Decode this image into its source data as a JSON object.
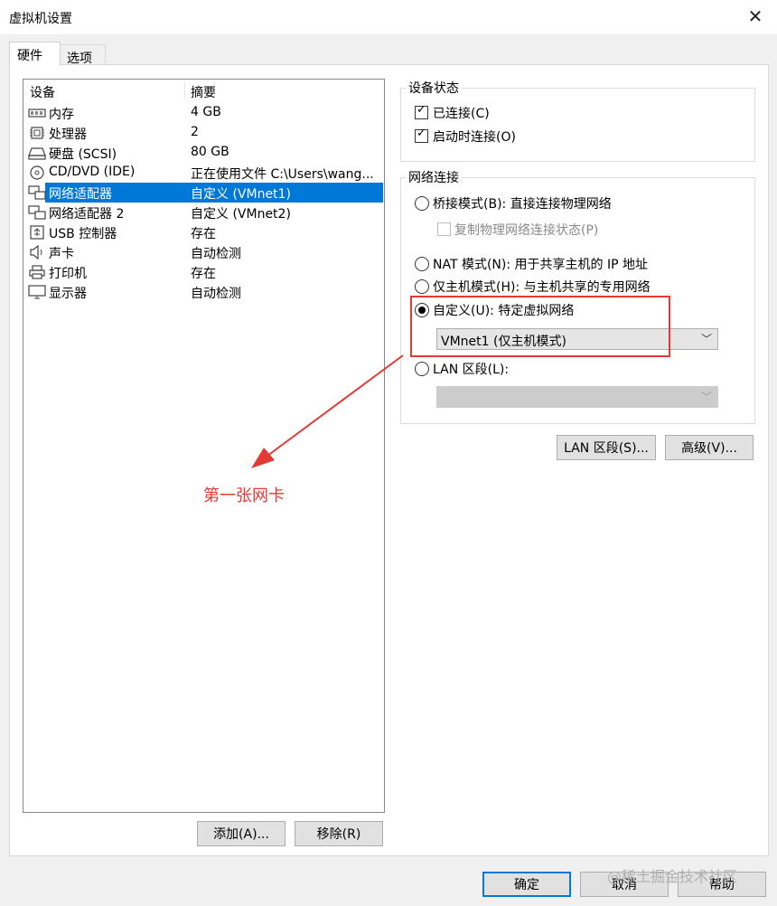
{
  "window": {
    "title": "虚拟机设置",
    "close_glyph": "✕"
  },
  "tabs": [
    {
      "label": "硬件"
    },
    {
      "label": "选项"
    }
  ],
  "device_list": {
    "headers": {
      "device": "设备",
      "summary": "摘要"
    },
    "rows": [
      {
        "icon": "memory-icon",
        "name": "内存",
        "summary": "4 GB"
      },
      {
        "icon": "processor-icon",
        "name": "处理器",
        "summary": "2"
      },
      {
        "icon": "hard-disk-icon",
        "name": "硬盘 (SCSI)",
        "summary": "80 GB"
      },
      {
        "icon": "cd-dvd-icon",
        "name": "CD/DVD (IDE)",
        "summary": "正在使用文件 C:\\Users\\wang..."
      },
      {
        "icon": "network-adapter-icon",
        "name": "网络适配器",
        "summary": "自定义 (VMnet1)",
        "selected": true
      },
      {
        "icon": "network-adapter-icon",
        "name": "网络适配器 2",
        "summary": "自定义 (VMnet2)"
      },
      {
        "icon": "usb-icon",
        "name": "USB 控制器",
        "summary": "存在"
      },
      {
        "icon": "speaker-icon",
        "name": "声卡",
        "summary": "自动检测"
      },
      {
        "icon": "printer-icon",
        "name": "打印机",
        "summary": "存在"
      },
      {
        "icon": "monitor-icon",
        "name": "显示器",
        "summary": "自动检测"
      }
    ],
    "add_button": "添加(A)...",
    "remove_button": "移除(R)"
  },
  "device_status": {
    "title": "设备状态",
    "connected": {
      "label": "已连接(C)",
      "checked": true
    },
    "connect_at_power_on": {
      "label": "启动时连接(O)",
      "checked": true
    }
  },
  "network_connection": {
    "title": "网络连接",
    "bridged": {
      "label": "桥接模式(B): 直接连接物理网络",
      "selected": false
    },
    "replicate": {
      "label": "复制物理网络连接状态(P)",
      "checked": false,
      "disabled": true
    },
    "nat": {
      "label": "NAT 模式(N): 用于共享主机的 IP 地址",
      "selected": false
    },
    "host_only": {
      "label": "仅主机模式(H): 与主机共享的专用网络",
      "selected": false
    },
    "custom": {
      "label": "自定义(U): 特定虚拟网络",
      "selected": true
    },
    "custom_value": "VMnet1 (仅主机模式)",
    "lan_segment": {
      "label": "LAN 区段(L):",
      "selected": false
    },
    "lan_segment_value": ""
  },
  "buttons": {
    "lan_segments": "LAN 区段(S)...",
    "advanced": "高级(V)...",
    "ok": "确定",
    "cancel": "取消",
    "help": "帮助"
  },
  "annotation": {
    "text": "第一张网卡",
    "color": "#e53935"
  },
  "watermark": "@稀土掘金技术社区",
  "colors": {
    "selection": "#0078d7",
    "highlight": "#e53935"
  }
}
